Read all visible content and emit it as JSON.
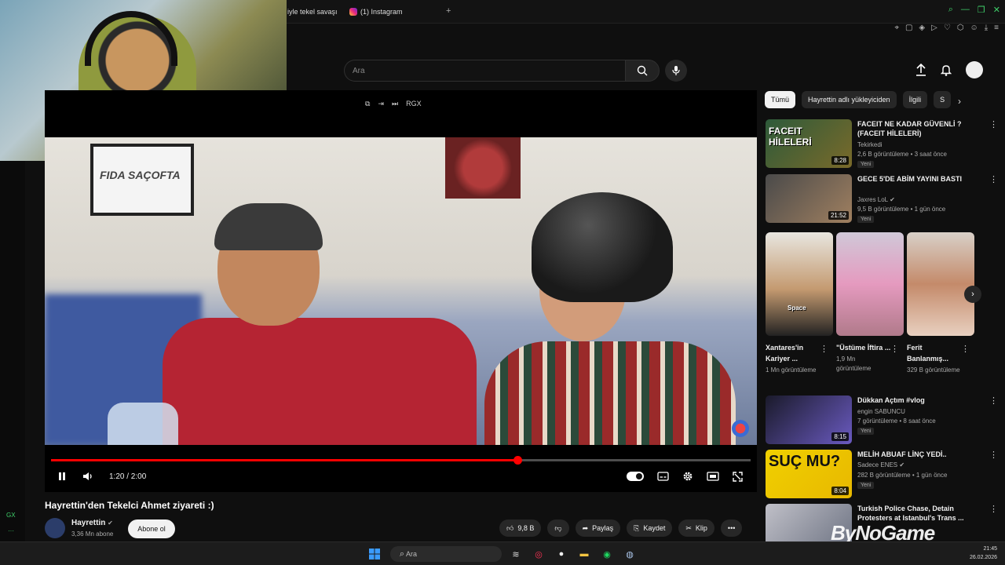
{
  "browser": {
    "tabs": [
      {
        "label": "iyle tekel savaşı"
      },
      {
        "label": "(1) Instagram"
      }
    ],
    "new_tab": "+"
  },
  "sidebar": {
    "gx_label": "GX",
    "dots": "···"
  },
  "header": {
    "search_placeholder": "Ara"
  },
  "player": {
    "top_controls": [
      "RGX"
    ],
    "time_display": "1:20 / 2:00",
    "progress_fraction": 0.667,
    "wall_sign": "FIDA SAÇOFTA"
  },
  "video": {
    "title": "Hayrettin'den Tekelci Ahmet ziyareti :)",
    "channel_name": "Hayrettin",
    "subscribers": "3,36 Mn abone",
    "subscribe_label": "Abone ol",
    "likes": "9,8 B",
    "share_label": "Paylaş",
    "save_label": "Kaydet",
    "clip_label": "Klip",
    "more_label": "•••"
  },
  "chips": [
    {
      "label": "Tümü",
      "active": true
    },
    {
      "label": "Hayrettin adlı yükleyiciden",
      "active": false
    },
    {
      "label": "İlgili",
      "active": false
    },
    {
      "label": "S",
      "active": false
    }
  ],
  "recommendations": [
    {
      "title": "FACEIT NE KADAR GÜVENLİ ? (FACEIT HİLELERİ)",
      "channel": "Tekirkedi",
      "meta": "2,6 B görüntüleme • 3 saat önce",
      "badge": "Yeni",
      "duration": "8:28",
      "thumb_text": "FACEIT HİLELERİ",
      "verified": false
    },
    {
      "title": "GECE 5'DE ABİM YAYINI BASTI",
      "channel": "Jaxres LoL",
      "meta": "9,5 B görüntüleme • 1 gün önce",
      "badge": "Yeni",
      "duration": "21:52",
      "thumb_text": "",
      "verified": true
    },
    {
      "title": "Dükkan Açtım #vlog",
      "channel": "engin SABUNCU",
      "meta": "7 görüntüleme • 8 saat önce",
      "badge": "Yeni",
      "duration": "8:15",
      "thumb_text": "",
      "verified": false
    },
    {
      "title": "MELİH ABUAF LİNÇ YEDİ..",
      "channel": "Sadece ENES",
      "meta": "282 B görüntüleme • 1 gün önce",
      "badge": "Yeni",
      "duration": "8:04",
      "thumb_text": "SUÇ MU?",
      "verified": true
    },
    {
      "title": "Turkish Police Chase, Detain Protesters at Istanbul's Trans ...",
      "channel": "",
      "meta": "",
      "badge": "",
      "duration": "",
      "thumb_text": "",
      "verified": false
    }
  ],
  "shorts": [
    {
      "title": "Xantares'in Kariyer ...",
      "views": "1 Mn görüntüleme",
      "thumb_text": "Space"
    },
    {
      "title": "\"Üstüme İftira ...",
      "views": "1,9 Mn görüntüleme",
      "thumb_text": ""
    },
    {
      "title": "Ferit Banlanmış...",
      "views": "329 B görüntüleme",
      "thumb_text": ""
    }
  ],
  "taskbar": {
    "search_placeholder": "Ara",
    "time": "21:45",
    "date": "26.02.2026"
  },
  "watermark": "ByNoGame",
  "colors": {
    "background": "#0f0f0f",
    "progress": "#ff0000",
    "accent_green": "#3fd06a"
  }
}
